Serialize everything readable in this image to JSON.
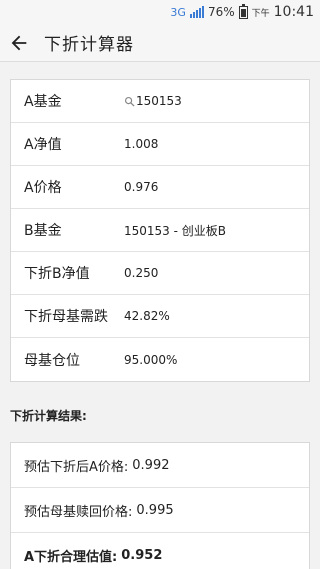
{
  "status_bar": {
    "network": "3G",
    "battery": "76%",
    "ampm": "下午",
    "time": "10:41"
  },
  "app_bar": {
    "title": "下折计算器",
    "back_icon": "arrow-left-icon"
  },
  "inputs": [
    {
      "label": "A基金",
      "value": "150153",
      "has_search": true
    },
    {
      "label": "A净值",
      "value": "1.008"
    },
    {
      "label": "A价格",
      "value": "0.976"
    },
    {
      "label": "B基金",
      "value": "150153 - 创业板B"
    },
    {
      "label": "下折B净值",
      "value": "0.250"
    },
    {
      "label": "下折母基需跌",
      "value": "42.82%"
    },
    {
      "label": "母基仓位",
      "value": "95.000%"
    }
  ],
  "results_title": "下折计算结果:",
  "results": [
    {
      "label": "预估下折后A价格:",
      "value": "0.992"
    },
    {
      "label": "预估母基赎回价格:",
      "value": "0.995"
    },
    {
      "label": "A下折合理估值:",
      "value": "0.952"
    }
  ]
}
